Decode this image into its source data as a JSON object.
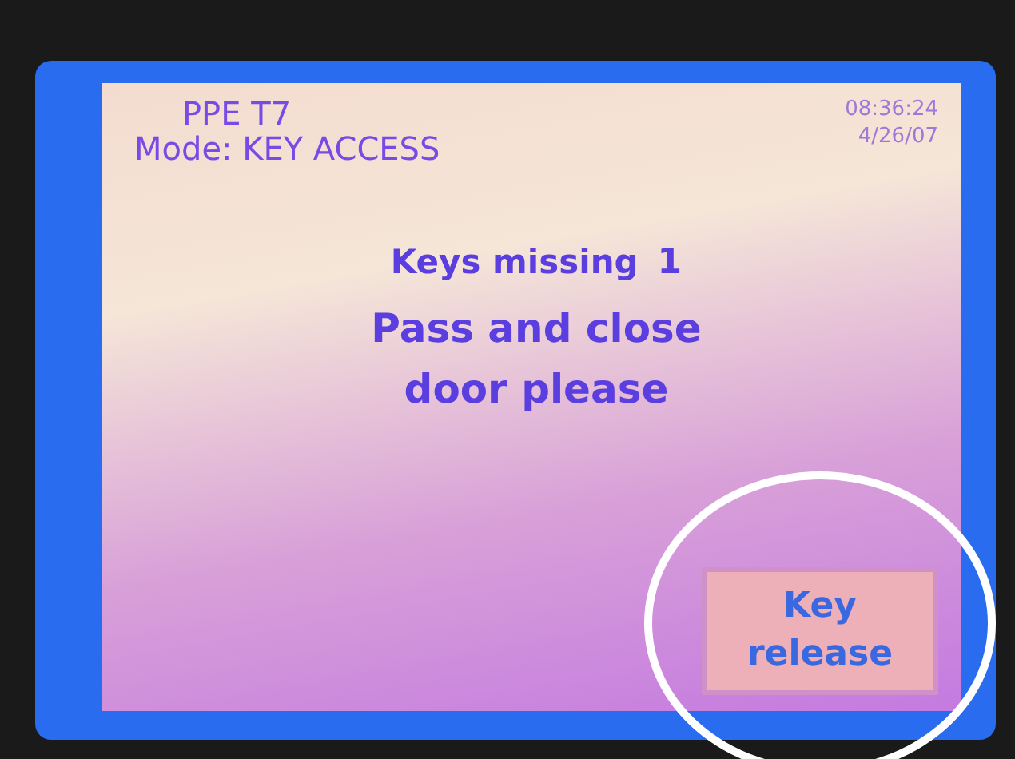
{
  "header": {
    "device": "PPE T7",
    "mode": "Mode: KEY ACCESS",
    "time": "08:36:24",
    "date": "4/26/07"
  },
  "message": {
    "label": "Keys missing",
    "count": "1",
    "instruction": "Pass and close door please"
  },
  "buttons": [
    {
      "label": "Key release",
      "highlighted": true
    }
  ]
}
